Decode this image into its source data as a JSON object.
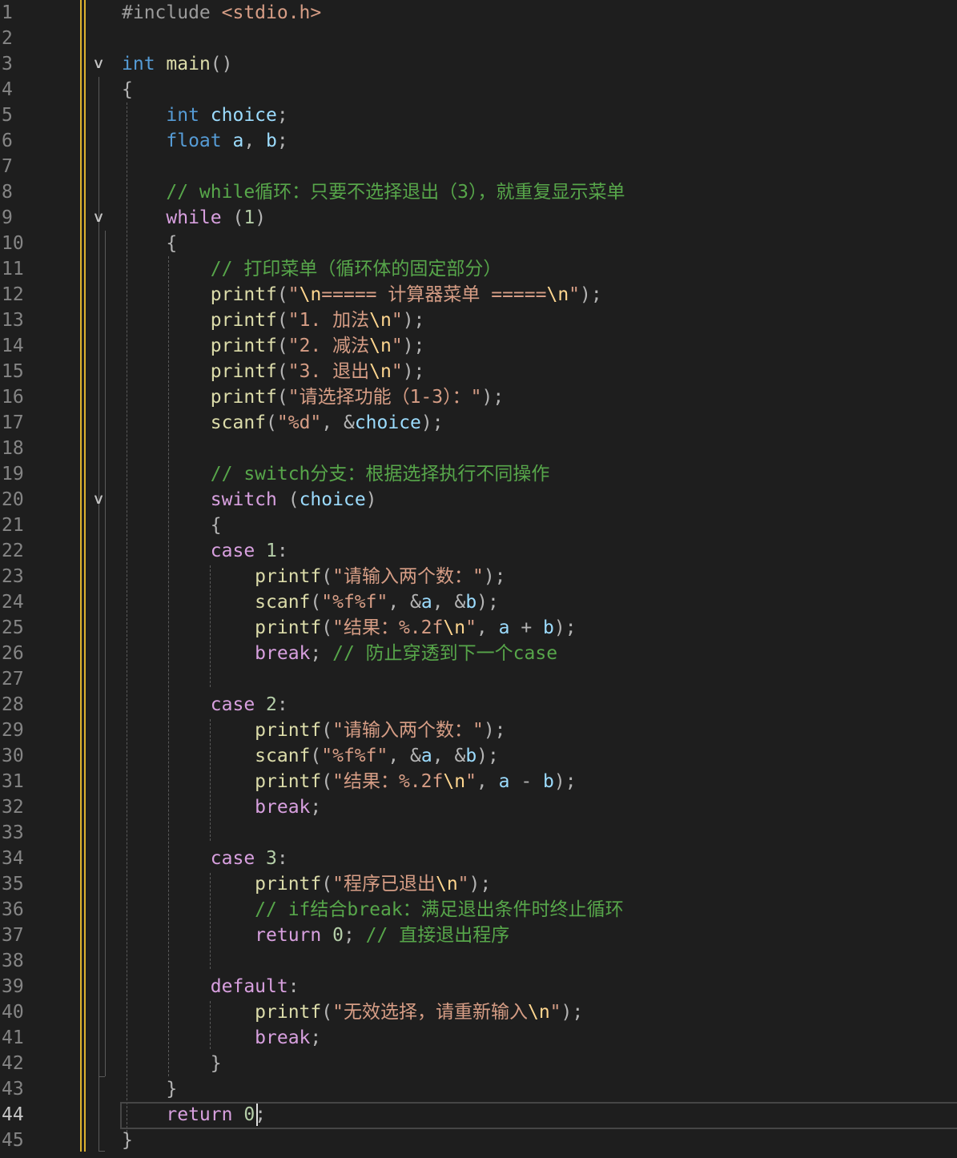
{
  "editor": {
    "language": "C",
    "active_line": 44,
    "lines": [
      {
        "n": "1",
        "tokens": [
          [
            "pp",
            "#include "
          ],
          [
            "hdr",
            "<stdio.h>"
          ]
        ]
      },
      {
        "n": "2",
        "tokens": []
      },
      {
        "n": "3",
        "tokens": [
          [
            "kw",
            "int"
          ],
          [
            "pn",
            " "
          ],
          [
            "fn",
            "main"
          ],
          [
            "pn",
            "()"
          ]
        ]
      },
      {
        "n": "4",
        "tokens": [
          [
            "pn",
            "{"
          ]
        ]
      },
      {
        "n": "5",
        "tokens": [
          [
            "kw",
            "    int"
          ],
          [
            "pn",
            " "
          ],
          [
            "var",
            "choice"
          ],
          [
            "pn",
            ";"
          ]
        ]
      },
      {
        "n": "6",
        "tokens": [
          [
            "kw",
            "    float"
          ],
          [
            "pn",
            " "
          ],
          [
            "var",
            "a"
          ],
          [
            "pn",
            ", "
          ],
          [
            "var",
            "b"
          ],
          [
            "pn",
            ";"
          ]
        ]
      },
      {
        "n": "7",
        "tokens": []
      },
      {
        "n": "8",
        "tokens": [
          [
            "cm",
            "    // while循环：只要不选择退出（3），就重复显示菜单"
          ]
        ]
      },
      {
        "n": "9",
        "tokens": [
          [
            "ctl",
            "    while"
          ],
          [
            "pn",
            " ("
          ],
          [
            "num",
            "1"
          ],
          [
            "pn",
            ")"
          ]
        ]
      },
      {
        "n": "10",
        "tokens": [
          [
            "pn",
            "    {"
          ]
        ]
      },
      {
        "n": "11",
        "tokens": [
          [
            "cm",
            "        // 打印菜单（循环体的固定部分）"
          ]
        ]
      },
      {
        "n": "12",
        "tokens": [
          [
            "fn",
            "        printf"
          ],
          [
            "pn",
            "("
          ],
          [
            "str",
            "\""
          ],
          [
            "esc",
            "\\n"
          ],
          [
            "str",
            "===== 计算器菜单 ====="
          ],
          [
            "esc",
            "\\n"
          ],
          [
            "str",
            "\""
          ],
          [
            "pn",
            ");"
          ]
        ]
      },
      {
        "n": "13",
        "tokens": [
          [
            "fn",
            "        printf"
          ],
          [
            "pn",
            "("
          ],
          [
            "str",
            "\"1. 加法"
          ],
          [
            "esc",
            "\\n"
          ],
          [
            "str",
            "\""
          ],
          [
            "pn",
            ");"
          ]
        ]
      },
      {
        "n": "14",
        "tokens": [
          [
            "fn",
            "        printf"
          ],
          [
            "pn",
            "("
          ],
          [
            "str",
            "\"2. 减法"
          ],
          [
            "esc",
            "\\n"
          ],
          [
            "str",
            "\""
          ],
          [
            "pn",
            ");"
          ]
        ]
      },
      {
        "n": "15",
        "tokens": [
          [
            "fn",
            "        printf"
          ],
          [
            "pn",
            "("
          ],
          [
            "str",
            "\"3. 退出"
          ],
          [
            "esc",
            "\\n"
          ],
          [
            "str",
            "\""
          ],
          [
            "pn",
            ");"
          ]
        ]
      },
      {
        "n": "16",
        "tokens": [
          [
            "fn",
            "        printf"
          ],
          [
            "pn",
            "("
          ],
          [
            "str",
            "\"请选择功能（1-3）：\""
          ],
          [
            "pn",
            ");"
          ]
        ]
      },
      {
        "n": "17",
        "tokens": [
          [
            "fn",
            "        scanf"
          ],
          [
            "pn",
            "("
          ],
          [
            "str",
            "\"%d\""
          ],
          [
            "pn",
            ", &"
          ],
          [
            "var",
            "choice"
          ],
          [
            "pn",
            ");"
          ]
        ]
      },
      {
        "n": "18",
        "tokens": []
      },
      {
        "n": "19",
        "tokens": [
          [
            "cm",
            "        // switch分支：根据选择执行不同操作"
          ]
        ]
      },
      {
        "n": "20",
        "tokens": [
          [
            "ctl",
            "        switch"
          ],
          [
            "pn",
            " ("
          ],
          [
            "var",
            "choice"
          ],
          [
            "pn",
            ")"
          ]
        ]
      },
      {
        "n": "21",
        "tokens": [
          [
            "pn",
            "        {"
          ]
        ]
      },
      {
        "n": "22",
        "tokens": [
          [
            "ctl",
            "        case"
          ],
          [
            "pn",
            " "
          ],
          [
            "num",
            "1"
          ],
          [
            "pn",
            ":"
          ]
        ]
      },
      {
        "n": "23",
        "tokens": [
          [
            "fn",
            "            printf"
          ],
          [
            "pn",
            "("
          ],
          [
            "str",
            "\"请输入两个数：\""
          ],
          [
            "pn",
            ");"
          ]
        ]
      },
      {
        "n": "24",
        "tokens": [
          [
            "fn",
            "            scanf"
          ],
          [
            "pn",
            "("
          ],
          [
            "str",
            "\"%f%f\""
          ],
          [
            "pn",
            ", &"
          ],
          [
            "var",
            "a"
          ],
          [
            "pn",
            ", &"
          ],
          [
            "var",
            "b"
          ],
          [
            "pn",
            ");"
          ]
        ]
      },
      {
        "n": "25",
        "tokens": [
          [
            "fn",
            "            printf"
          ],
          [
            "pn",
            "("
          ],
          [
            "str",
            "\"结果：%.2f"
          ],
          [
            "esc",
            "\\n"
          ],
          [
            "str",
            "\""
          ],
          [
            "pn",
            ", "
          ],
          [
            "var",
            "a"
          ],
          [
            "pn",
            " + "
          ],
          [
            "var",
            "b"
          ],
          [
            "pn",
            ");"
          ]
        ]
      },
      {
        "n": "26",
        "tokens": [
          [
            "ctl",
            "            break"
          ],
          [
            "pn",
            "; "
          ],
          [
            "cm",
            "// 防止穿透到下一个case"
          ]
        ]
      },
      {
        "n": "27",
        "tokens": []
      },
      {
        "n": "28",
        "tokens": [
          [
            "ctl",
            "        case"
          ],
          [
            "pn",
            " "
          ],
          [
            "num",
            "2"
          ],
          [
            "pn",
            ":"
          ]
        ]
      },
      {
        "n": "29",
        "tokens": [
          [
            "fn",
            "            printf"
          ],
          [
            "pn",
            "("
          ],
          [
            "str",
            "\"请输入两个数：\""
          ],
          [
            "pn",
            ");"
          ]
        ]
      },
      {
        "n": "30",
        "tokens": [
          [
            "fn",
            "            scanf"
          ],
          [
            "pn",
            "("
          ],
          [
            "str",
            "\"%f%f\""
          ],
          [
            "pn",
            ", &"
          ],
          [
            "var",
            "a"
          ],
          [
            "pn",
            ", &"
          ],
          [
            "var",
            "b"
          ],
          [
            "pn",
            ");"
          ]
        ]
      },
      {
        "n": "31",
        "tokens": [
          [
            "fn",
            "            printf"
          ],
          [
            "pn",
            "("
          ],
          [
            "str",
            "\"结果：%.2f"
          ],
          [
            "esc",
            "\\n"
          ],
          [
            "str",
            "\""
          ],
          [
            "pn",
            ", "
          ],
          [
            "var",
            "a"
          ],
          [
            "pn",
            " - "
          ],
          [
            "var",
            "b"
          ],
          [
            "pn",
            ");"
          ]
        ]
      },
      {
        "n": "32",
        "tokens": [
          [
            "ctl",
            "            break"
          ],
          [
            "pn",
            ";"
          ]
        ]
      },
      {
        "n": "33",
        "tokens": []
      },
      {
        "n": "34",
        "tokens": [
          [
            "ctl",
            "        case"
          ],
          [
            "pn",
            " "
          ],
          [
            "num",
            "3"
          ],
          [
            "pn",
            ":"
          ]
        ]
      },
      {
        "n": "35",
        "tokens": [
          [
            "fn",
            "            printf"
          ],
          [
            "pn",
            "("
          ],
          [
            "str",
            "\"程序已退出"
          ],
          [
            "esc",
            "\\n"
          ],
          [
            "str",
            "\""
          ],
          [
            "pn",
            ");"
          ]
        ]
      },
      {
        "n": "36",
        "tokens": [
          [
            "cm",
            "            // if结合break：满足退出条件时终止循环"
          ]
        ]
      },
      {
        "n": "37",
        "tokens": [
          [
            "ctl",
            "            return"
          ],
          [
            "pn",
            " "
          ],
          [
            "num",
            "0"
          ],
          [
            "pn",
            "; "
          ],
          [
            "cm",
            "// 直接退出程序"
          ]
        ]
      },
      {
        "n": "38",
        "tokens": []
      },
      {
        "n": "39",
        "tokens": [
          [
            "ctl",
            "        default"
          ],
          [
            "pn",
            ":"
          ]
        ]
      },
      {
        "n": "40",
        "tokens": [
          [
            "fn",
            "            printf"
          ],
          [
            "pn",
            "("
          ],
          [
            "str",
            "\"无效选择，请重新输入"
          ],
          [
            "esc",
            "\\n"
          ],
          [
            "str",
            "\""
          ],
          [
            "pn",
            ");"
          ]
        ]
      },
      {
        "n": "41",
        "tokens": [
          [
            "ctl",
            "            break"
          ],
          [
            "pn",
            ";"
          ]
        ]
      },
      {
        "n": "42",
        "tokens": [
          [
            "pn",
            "        }"
          ]
        ]
      },
      {
        "n": "43",
        "tokens": [
          [
            "pn",
            "    }"
          ]
        ]
      },
      {
        "n": "44",
        "tokens": [
          [
            "ctl",
            "    return"
          ],
          [
            "pn",
            " "
          ],
          [
            "num",
            "0"
          ],
          [
            "pn",
            ";"
          ]
        ]
      },
      {
        "n": "45",
        "tokens": [
          [
            "pn",
            "}"
          ]
        ]
      }
    ],
    "fold_markers": [
      {
        "line": 3,
        "icon": "chevron-down-icon",
        "glyph": "∨"
      },
      {
        "line": 9,
        "icon": "chevron-down-icon",
        "glyph": "∨"
      },
      {
        "line": 20,
        "icon": "chevron-down-icon",
        "glyph": "∨"
      }
    ]
  },
  "colors": {
    "background": "#1e1e1e",
    "keyword": "#569cd6",
    "control": "#d8a0df",
    "function": "#dcdcaa",
    "variable": "#9cdcfe",
    "string": "#d69d85",
    "escape": "#ffd68f",
    "number": "#b5cea8",
    "comment": "#57a64a",
    "change_bar": "#ffcc33"
  }
}
